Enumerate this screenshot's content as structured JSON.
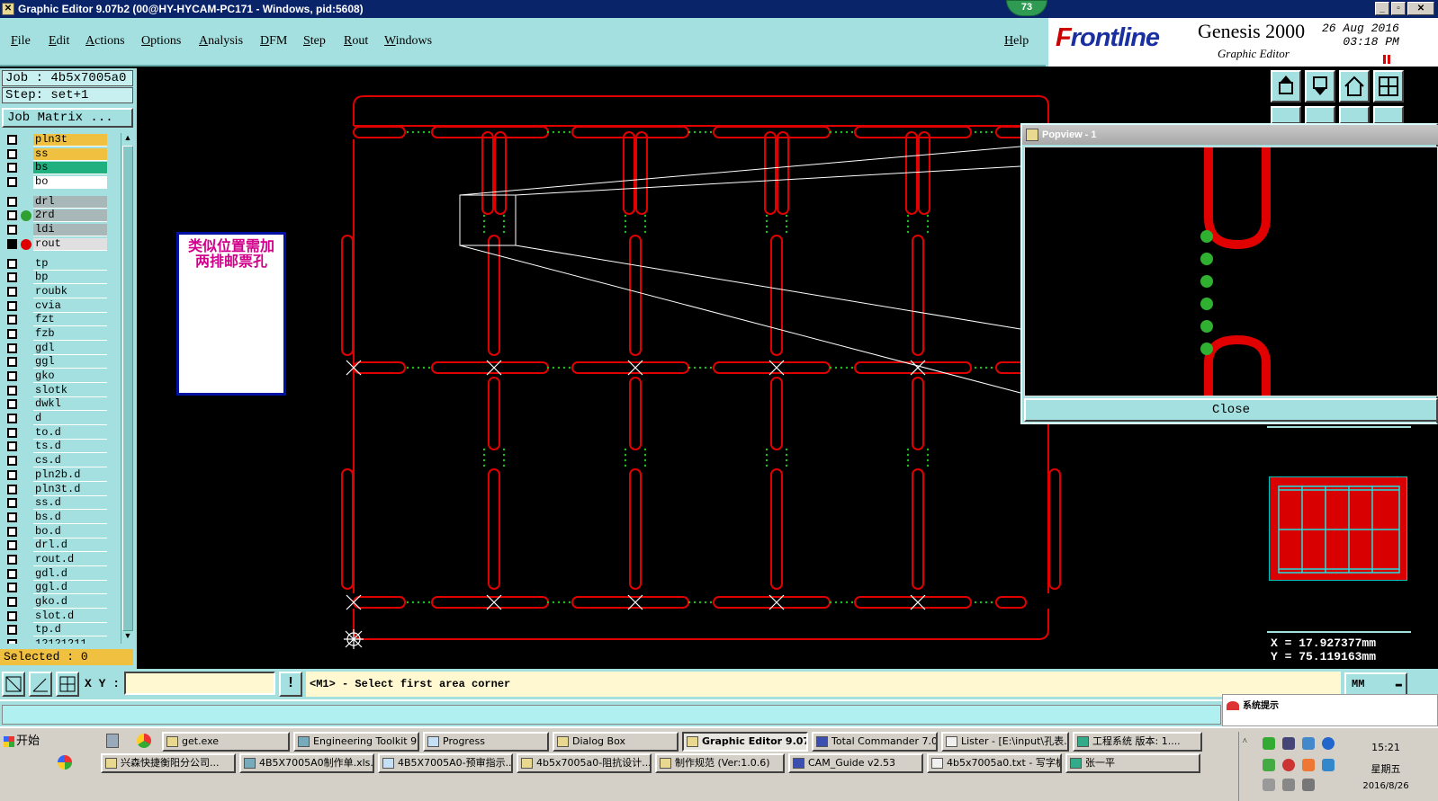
{
  "window": {
    "title": "Graphic Editor 9.07b2 (00@HY-HYCAM-PC171 - Windows, pid:5608)",
    "badge": "73"
  },
  "menu": [
    "File",
    "Edit",
    "Actions",
    "Options",
    "Analysis",
    "DFM",
    "Step",
    "Rout",
    "Windows"
  ],
  "help": "Help",
  "brand": {
    "logo_prefix": "F",
    "logo_rest": "rontline",
    "product": "Genesis 2000",
    "subtitle": "Graphic Editor",
    "date": "26 Aug 2016",
    "time": "03:18 PM"
  },
  "job": {
    "job_label": "Job : 4b5x7005a0",
    "step_label": "Step: set+1",
    "matrix_button": "Job Matrix ..."
  },
  "layers": [
    {
      "name": "pln3t",
      "color": "#f0c040",
      "checked": false,
      "dot": ""
    },
    {
      "name": "ss",
      "color": "#f0c040",
      "checked": false,
      "dot": ""
    },
    {
      "name": "bs",
      "color": "#20b080",
      "checked": false,
      "dot": ""
    },
    {
      "name": "bo",
      "color": "#ffffff",
      "checked": false,
      "dot": ""
    },
    {
      "gap": true
    },
    {
      "name": "drl",
      "color": "#a8b8b8",
      "checked": false,
      "dot": ""
    },
    {
      "name": "2rd",
      "color": "#a8b8b8",
      "checked": false,
      "dot": "#30a030"
    },
    {
      "name": "ldi",
      "color": "#a8b8b8",
      "checked": false,
      "dot": ""
    },
    {
      "name": "rout",
      "color": "#e0e0e0",
      "checked": true,
      "dot": "#e00000"
    },
    {
      "gap": true
    },
    {
      "name": "tp",
      "color": "#a4e0e0",
      "checked": false,
      "dot": ""
    },
    {
      "name": "bp",
      "color": "#a4e0e0",
      "checked": false,
      "dot": ""
    },
    {
      "name": "roubk",
      "color": "#a4e0e0",
      "checked": false,
      "dot": ""
    },
    {
      "name": "cvia",
      "color": "#a4e0e0",
      "checked": false,
      "dot": ""
    },
    {
      "name": "fzt",
      "color": "#a4e0e0",
      "checked": false,
      "dot": ""
    },
    {
      "name": "fzb",
      "color": "#a4e0e0",
      "checked": false,
      "dot": ""
    },
    {
      "name": "gdl",
      "color": "#a4e0e0",
      "checked": false,
      "dot": ""
    },
    {
      "name": "ggl",
      "color": "#a4e0e0",
      "checked": false,
      "dot": ""
    },
    {
      "name": "gko",
      "color": "#a4e0e0",
      "checked": false,
      "dot": ""
    },
    {
      "name": "slotk",
      "color": "#a4e0e0",
      "checked": false,
      "dot": ""
    },
    {
      "name": "dwkl",
      "color": "#a4e0e0",
      "checked": false,
      "dot": ""
    },
    {
      "name": "d",
      "color": "#a4e0e0",
      "checked": false,
      "dot": ""
    },
    {
      "name": "to.d",
      "color": "#a4e0e0",
      "checked": false,
      "dot": ""
    },
    {
      "name": "ts.d",
      "color": "#a4e0e0",
      "checked": false,
      "dot": ""
    },
    {
      "name": "cs.d",
      "color": "#a4e0e0",
      "checked": false,
      "dot": ""
    },
    {
      "name": "pln2b.d",
      "color": "#a4e0e0",
      "checked": false,
      "dot": ""
    },
    {
      "name": "pln3t.d",
      "color": "#a4e0e0",
      "checked": false,
      "dot": ""
    },
    {
      "name": "ss.d",
      "color": "#a4e0e0",
      "checked": false,
      "dot": ""
    },
    {
      "name": "bs.d",
      "color": "#a4e0e0",
      "checked": false,
      "dot": ""
    },
    {
      "name": "bo.d",
      "color": "#a4e0e0",
      "checked": false,
      "dot": ""
    },
    {
      "name": "drl.d",
      "color": "#a4e0e0",
      "checked": false,
      "dot": ""
    },
    {
      "name": "rout.d",
      "color": "#a4e0e0",
      "checked": false,
      "dot": ""
    },
    {
      "name": "gdl.d",
      "color": "#a4e0e0",
      "checked": false,
      "dot": ""
    },
    {
      "name": "ggl.d",
      "color": "#a4e0e0",
      "checked": false,
      "dot": ""
    },
    {
      "name": "gko.d",
      "color": "#a4e0e0",
      "checked": false,
      "dot": ""
    },
    {
      "name": "slot.d",
      "color": "#a4e0e0",
      "checked": false,
      "dot": ""
    },
    {
      "name": "tp.d",
      "color": "#a4e0e0",
      "checked": false,
      "dot": ""
    },
    {
      "name": "12121211",
      "color": "#a4e0e0",
      "checked": false,
      "dot": ""
    }
  ],
  "selected_label": "Selected : 0",
  "note": {
    "line1": "类似位置需加",
    "line2": "两排邮票孔"
  },
  "popview": {
    "title": "Popview - 1",
    "close_label": "Close"
  },
  "coords": {
    "x": "X = 17.927377mm",
    "y": "Y = 75.119163mm"
  },
  "command": {
    "xy_label": "X Y :",
    "xy_value": "",
    "message": "<M1> - Select first area corner",
    "unit": "MM"
  },
  "system_tip": "系统提示",
  "taskbar": {
    "start": "开始",
    "row1": [
      {
        "label": "get.exe",
        "active": false
      },
      {
        "label": "Engineering Toolkit 9....",
        "active": false
      },
      {
        "label": "Progress",
        "active": false
      },
      {
        "label": "Dialog Box",
        "active": false
      },
      {
        "label": "Graphic Editor 9.07...",
        "active": true
      },
      {
        "label": "Total Commander 7.0 ...",
        "active": false
      },
      {
        "label": "Lister - [E:\\input\\孔表...",
        "active": false
      },
      {
        "label": "工程系统  版本: 1....",
        "active": false
      }
    ],
    "row2": [
      {
        "label": "兴森快捷衡阳分公司...",
        "active": false
      },
      {
        "label": "4B5X7005A0制作单.xls...",
        "active": false
      },
      {
        "label": "4B5X7005A0-预审指示...",
        "active": false
      },
      {
        "label": "4b5x7005a0-阻抗设计...",
        "active": false
      },
      {
        "label": "制作规范 (Ver:1.0.6)",
        "active": false
      },
      {
        "label": "CAM_Guide v2.53",
        "active": false
      },
      {
        "label": "4b5x7005a0.txt - 写字板",
        "active": false
      },
      {
        "label": "张一平",
        "active": false
      }
    ],
    "clock_time": "15:21",
    "clock_day": "星期五",
    "clock_date": "2016/8/26"
  },
  "colors": {
    "panel": "#a4e0e0",
    "rout": "#e00000",
    "tab_dots": "#20c020",
    "titlebar": "#0a246a"
  }
}
